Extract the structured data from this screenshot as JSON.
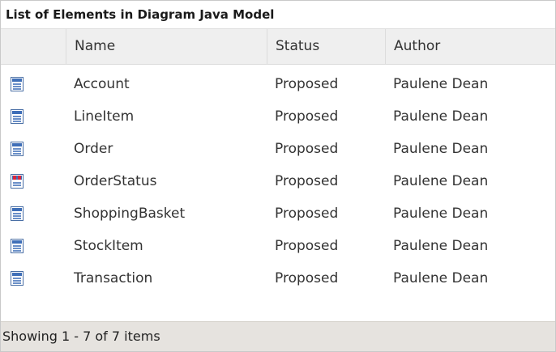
{
  "title": "List of Elements in Diagram Java Model",
  "columns": {
    "name": "Name",
    "status": "Status",
    "author": "Author"
  },
  "rows": [
    {
      "icon": "class-icon",
      "name": "Account",
      "status": "Proposed",
      "author": "Paulene Dean"
    },
    {
      "icon": "class-icon",
      "name": "LineItem",
      "status": "Proposed",
      "author": "Paulene Dean"
    },
    {
      "icon": "class-icon",
      "name": "Order",
      "status": "Proposed",
      "author": "Paulene Dean"
    },
    {
      "icon": "enumeration-icon",
      "name": "OrderStatus",
      "status": "Proposed",
      "author": "Paulene Dean"
    },
    {
      "icon": "class-icon",
      "name": "ShoppingBasket",
      "status": "Proposed",
      "author": "Paulene Dean"
    },
    {
      "icon": "class-icon",
      "name": "StockItem",
      "status": "Proposed",
      "author": "Paulene Dean"
    },
    {
      "icon": "class-icon",
      "name": "Transaction",
      "status": "Proposed",
      "author": "Paulene Dean"
    }
  ],
  "footer": "Showing 1 - 7 of 7 items"
}
